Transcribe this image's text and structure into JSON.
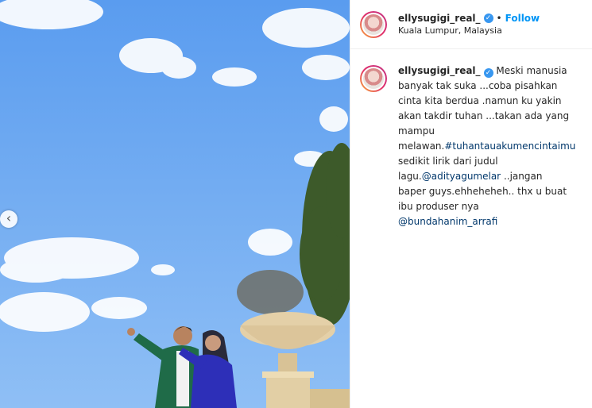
{
  "post": {
    "username": "ellysugigi_real_",
    "verified_symbol": "✓",
    "separator": "•",
    "follow_label": "Follow",
    "location": "Kuala Lumpur, Malaysia"
  },
  "caption": {
    "username": "ellysugigi_real_",
    "part1": " Meski manusia banyak tak suka ...coba pisahkan cinta kita berdua .namun ku yakin akan takdir tuhan ...takan ada yang mampu melawan.",
    "hashtag": "#tuhantauakumencintaimu",
    "part2": " sedikit lirik dari judul lagu.",
    "mention1": "@adityagumelar",
    "part3": " ..jangan baper guys.ehheheheh.. thx u buat ibu produser nya ",
    "mention2": "@bundahanim_arrafi"
  },
  "nav": {
    "prev_symbol": "‹"
  },
  "colors": {
    "sky_top": "#5b9ef0",
    "sky_bottom": "#9ec8f7",
    "link": "#00376b",
    "follow": "#0095f6"
  }
}
